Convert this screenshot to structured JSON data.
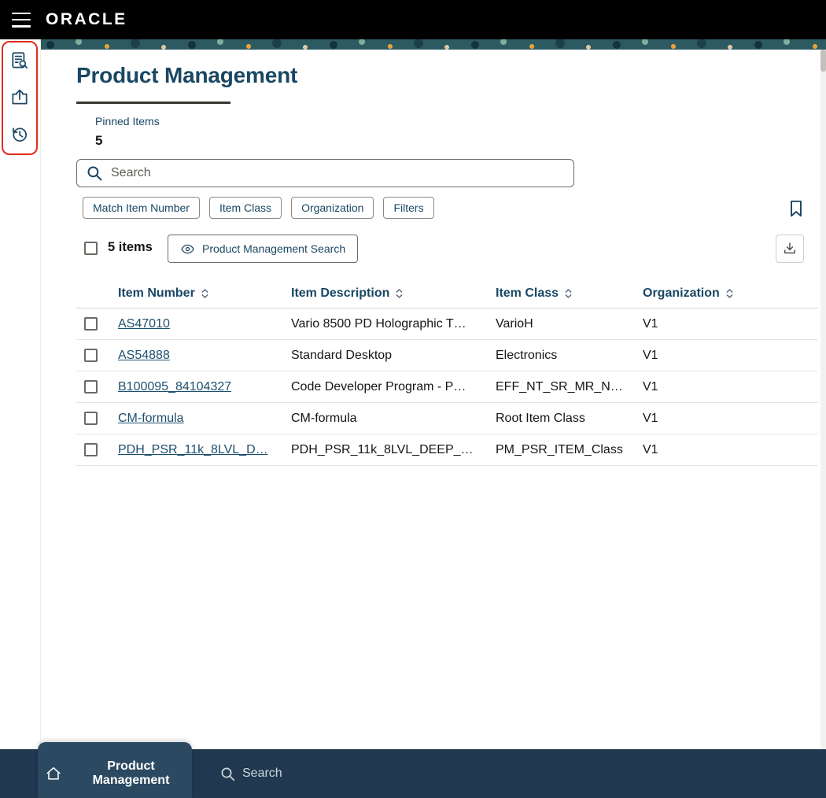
{
  "header": {
    "brand": "ORACLE"
  },
  "sidebar": {
    "icons": [
      "document-search-icon",
      "checkin-upload-icon",
      "history-icon"
    ],
    "highlighted": true
  },
  "page": {
    "title": "Product Management"
  },
  "pinned": {
    "label": "Pinned Items",
    "count": "5"
  },
  "search": {
    "placeholder": "Search"
  },
  "filters": {
    "chips": [
      "Match Item Number",
      "Item Class",
      "Organization",
      "Filters"
    ]
  },
  "results": {
    "count_label": "5 items",
    "saved_search_label": "Product Management Search"
  },
  "table": {
    "columns": [
      "Item Number",
      "Item Description",
      "Item Class",
      "Organization"
    ],
    "rows": [
      {
        "item_number": "AS47010",
        "description": "Vario 8500 PD Holographic T…",
        "item_class": "VarioH",
        "organization": "V1"
      },
      {
        "item_number": "AS54888",
        "description": "Standard Desktop",
        "item_class": "Electronics",
        "organization": "V1"
      },
      {
        "item_number": "B100095_84104327",
        "description": "Code Developer Program - P…",
        "item_class": "EFF_NT_SR_MR_N…",
        "organization": "V1"
      },
      {
        "item_number": "CM-formula",
        "description": "CM-formula",
        "item_class": "Root Item Class",
        "organization": "V1"
      },
      {
        "item_number": "PDH_PSR_11k_8LVL_D…",
        "description": "PDH_PSR_11k_8LVL_DEEP_…",
        "item_class": "PM_PSR_ITEM_Class",
        "organization": "V1"
      }
    ]
  },
  "footer": {
    "items": [
      {
        "label": "Product Management",
        "icon": "home-icon"
      },
      {
        "label": "Search",
        "icon": "search-icon"
      }
    ]
  },
  "colors": {
    "accent-red": "#e12b1d",
    "navy": "#1a4763",
    "link": "#1d4f6d",
    "text": "#161513",
    "footer-bg": "#203950",
    "footer-tab-bg": "#2b4961",
    "banner-teal": "#2c5a60"
  }
}
